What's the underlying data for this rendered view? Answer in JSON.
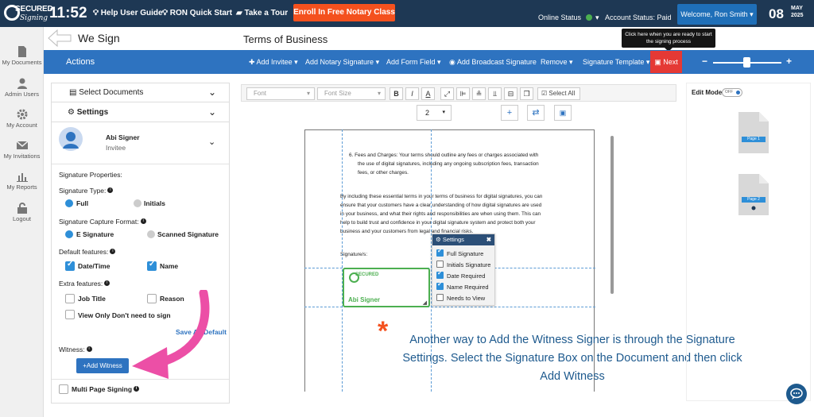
{
  "topbar": {
    "logo_text": "SECURED",
    "logo_sub": "Signing",
    "time": "11:52",
    "links": [
      "Help User Guide",
      "RON Quick Start",
      "Take a Tour"
    ],
    "enroll_label": "Enroll In Free Notary Class",
    "online_status": "Online Status",
    "account_status": "Account Status: Paid",
    "welcome": "Welcome, Ron Smith",
    "day": "08",
    "month": "MAY",
    "year": "2025",
    "tooltip": "Click here when you are ready to start the signing process"
  },
  "sidebar": {
    "items": [
      "My Documents",
      "Admin Users",
      "My Account",
      "My Invitations",
      "My Reports",
      "Logout"
    ]
  },
  "header": {
    "section": "We Sign",
    "doc_title": "Terms of Business"
  },
  "actionbar": {
    "label": "Actions",
    "menu": [
      "Add Invitee",
      "Add Notary Signature",
      "Add Form Field",
      "Add Broadcast Signature",
      "Remove",
      "Signature Template"
    ],
    "next": "Next",
    "zoom_level": 0.45
  },
  "leftpanel": {
    "select_documents": "Select Documents",
    "settings": "Settings",
    "signer_name": "Abi Signer",
    "signer_role": "Invitee",
    "signature_properties": "Signature Properties:",
    "signature_type": "Signature Type:",
    "type_full": "Full",
    "type_initials": "Initials",
    "capture_format": "Signature Capture Format:",
    "format_e": "E Signature",
    "format_scanned": "Scanned Signature",
    "default_features": "Default features:",
    "feat_datetime": "Date/Time",
    "feat_name": "Name",
    "extra_features": "Extra features:",
    "extra_jobtitle": "Job Title",
    "extra_reason": "Reason",
    "extra_viewonly": "View Only Don't need to sign",
    "save_default": "Save As Default",
    "witness": "Witness:",
    "add_witness": "+Add Witness",
    "multi_page": "Multi Page Signing"
  },
  "toolbar": {
    "font": "Font",
    "font_size": "Font Size",
    "select_all": "Select All",
    "page": "2"
  },
  "document": {
    "item6_line1": "6.   Fees and Charges: Your terms should outline any fees or charges associated with",
    "item6_line2": "the use of digital signatures, including any ongoing subscription fees, transaction",
    "item6_line3": "fees, or other charges.",
    "para_line1": "By including these essential terms in your terms of business for digital signatures, you can",
    "para_line2": "ensure that your customers have a clear understanding of how digital signatures are used",
    "para_line3": "in your business, and what their rights and responsibilities are when using them. This can",
    "para_line4": "help to build trust and confidence in your digital signature system and protect both your",
    "para_line5": "business and your customers from legal and financial risks.",
    "signatures_label": "Signature/s:",
    "sig_logo": "SECURED",
    "sig_name": "Abi Signer"
  },
  "settings_popup": {
    "title": "Settings",
    "items": [
      {
        "label": "Full Signature",
        "checked": true
      },
      {
        "label": "Initials Signature",
        "checked": false
      },
      {
        "label": "Date Required",
        "checked": true
      },
      {
        "label": "Name Required",
        "checked": true
      },
      {
        "label": "Needs to View",
        "checked": false
      }
    ]
  },
  "caption": "Another way to Add the Witness Signer is through the Signature Settings. Select the Signature Box on the Document and then click Add Witness",
  "rightpanel": {
    "edit_mode": "Edit Mode",
    "toggle": "OFF",
    "thumbs": [
      "Page 1",
      "Page 2"
    ]
  },
  "colors": {
    "topbar": "#1e3854",
    "actionbar": "#2e73c0",
    "next": "#e53935",
    "enroll": "#f4511e",
    "accent_arrow": "#ec4fa6",
    "sig_box": "#4caf50"
  }
}
